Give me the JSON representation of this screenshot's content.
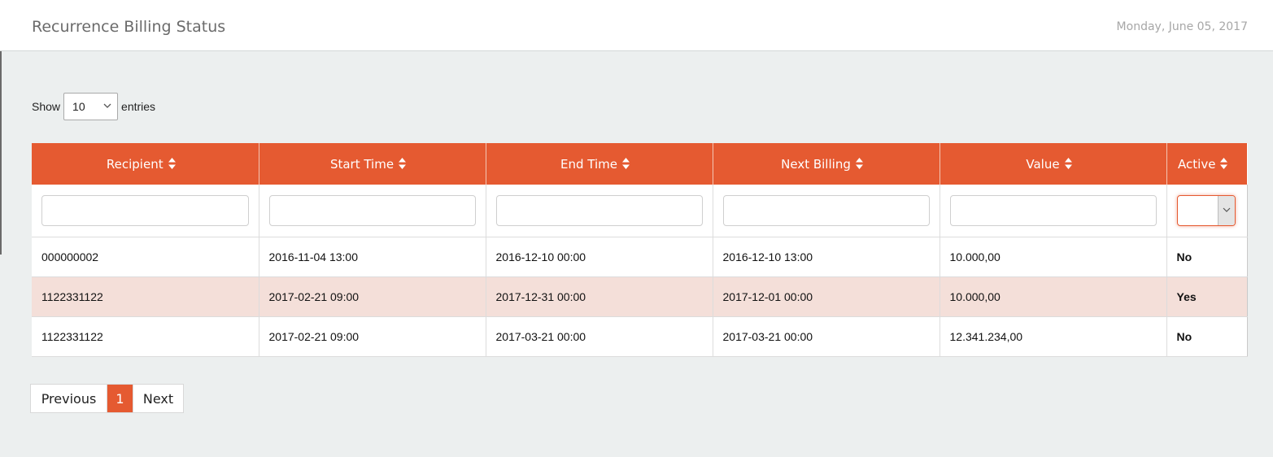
{
  "header": {
    "title": "Recurrence Billing Status",
    "date": "Monday, June 05, 2017"
  },
  "length_menu": {
    "show_label": "Show",
    "selected": "10",
    "entries_label": "entries"
  },
  "table": {
    "columns": [
      "Recipient",
      "Start Time",
      "End Time",
      "Next Billing",
      "Value",
      "Active"
    ],
    "rows": [
      [
        "000000002",
        "2016-11-04 13:00",
        "2016-12-10 00:00",
        "2016-12-10 13:00",
        "10.000,00",
        "No"
      ],
      [
        "1122331122",
        "2017-02-21 09:00",
        "2017-12-31 00:00",
        "2017-12-01 00:00",
        "10.000,00",
        "Yes"
      ],
      [
        "1122331122",
        "2017-02-21 09:00",
        "2017-03-21 00:00",
        "2017-03-21 00:00",
        "12.341.234,00",
        "No"
      ]
    ]
  },
  "pagination": {
    "previous": "Previous",
    "current": "1",
    "next": "Next"
  },
  "colors": {
    "accent": "#e55a31",
    "row_highlight": "#f4dfd9",
    "active_yes": "#2e9a1a",
    "active_no": "#e00000"
  }
}
